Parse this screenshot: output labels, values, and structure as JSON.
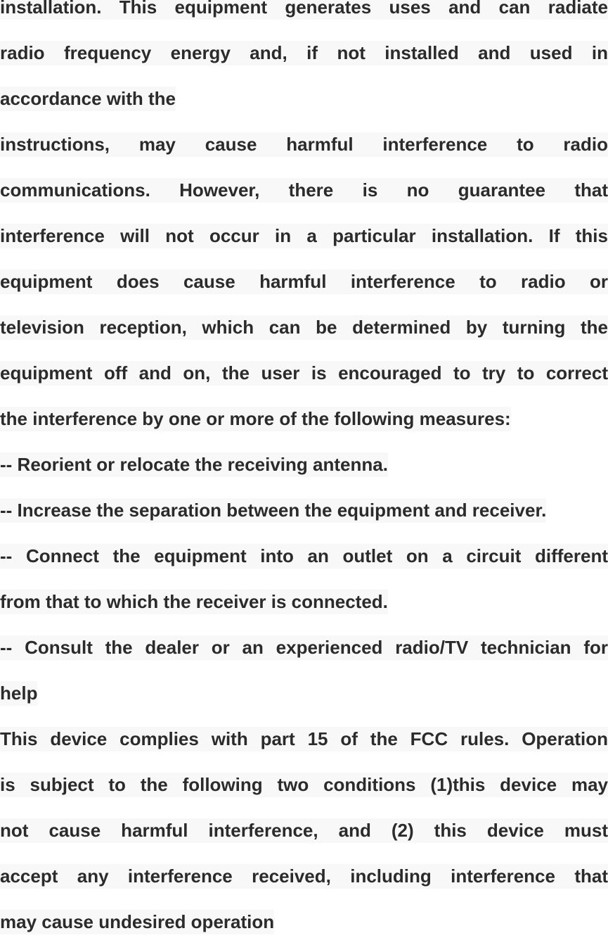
{
  "document": {
    "lines": [
      {
        "text": "installation. This equipment generates uses and can radiate",
        "justified": true
      },
      {
        "text": "radio frequency energy and, if not installed and used in",
        "justified": true
      },
      {
        "text": "accordance with the",
        "justified": false
      },
      {
        "text": "instructions, may cause harmful interference to radio",
        "justified": true
      },
      {
        "text": "communications. However, there is no guarantee that",
        "justified": true
      },
      {
        "text": "interference will not occur in a particular installation. If this",
        "justified": true
      },
      {
        "text": "equipment does cause harmful interference to radio or",
        "justified": true
      },
      {
        "text": "television reception, which can be determined by turning the",
        "justified": true
      },
      {
        "text": "equipment off and on, the user is encouraged to try to correct",
        "justified": true
      },
      {
        "text": "the interference by one or more of the following measures:",
        "justified": false
      },
      {
        "text": "-- Reorient or relocate the receiving antenna.",
        "justified": false
      },
      {
        "text": "-- Increase the separation between the equipment and receiver.",
        "justified": false
      },
      {
        "text": "-- Connect the equipment into an outlet on a circuit different",
        "justified": true
      },
      {
        "text": "from that to which the receiver is connected.",
        "justified": false
      },
      {
        "text": "-- Consult the dealer or an experienced radio/TV technician for",
        "justified": true
      },
      {
        "text": "help",
        "justified": false
      },
      {
        "text": "This device complies with part 15 of the FCC rules. Operation",
        "justified": true
      },
      {
        "text": "is subject to the following two conditions (1)this device may",
        "justified": true
      },
      {
        "text": "not cause harmful interference, and (2) this device must",
        "justified": true
      },
      {
        "text": "accept any interference received, including interference that",
        "justified": true
      },
      {
        "text": "may cause undesired operation",
        "justified": false
      }
    ]
  },
  "colors": {
    "text": "#2b2b2b",
    "highlight": "#f8f8f8",
    "background": "#ffffff"
  }
}
